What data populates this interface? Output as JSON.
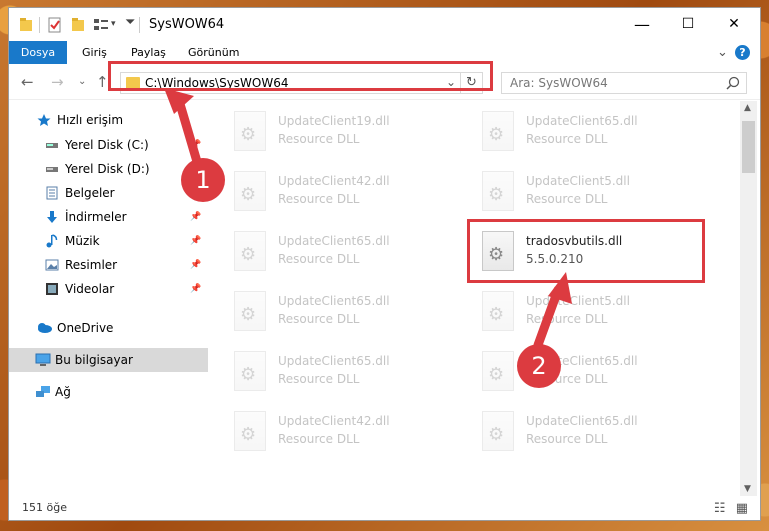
{
  "window": {
    "title": "SysWOW64",
    "controls": {
      "minimize": "—",
      "maximize": "☐",
      "close": "✕"
    }
  },
  "ribbon": {
    "tabs": [
      "Dosya",
      "Giriş",
      "Paylaş",
      "Görünüm"
    ],
    "active_tab": "Dosya",
    "expand_glyph": "⌄",
    "help": "?"
  },
  "addressbar": {
    "path": "C:\\Windows\\SysWOW64",
    "dropdown_glyph": "⌄",
    "refresh_glyph": "↻"
  },
  "search": {
    "placeholder": "Ara: SysWOW64",
    "icon": "search-icon"
  },
  "nav": {
    "back": "←",
    "forward": "→",
    "recent": "⌄",
    "up": "↑"
  },
  "navpane": {
    "items": [
      {
        "label": "Hızlı erişim",
        "icon": "star-icon",
        "pinned": false
      },
      {
        "label": "Yerel Disk (C:)",
        "icon": "drive-icon",
        "pinned": true
      },
      {
        "label": "Yerel Disk (D:)",
        "icon": "drive-icon",
        "pinned": true
      },
      {
        "label": "Belgeler",
        "icon": "document-icon",
        "pinned": true
      },
      {
        "label": "İndirmeler",
        "icon": "download-icon",
        "pinned": true
      },
      {
        "label": "Müzik",
        "icon": "music-icon",
        "pinned": true
      },
      {
        "label": "Resimler",
        "icon": "pictures-icon",
        "pinned": true
      },
      {
        "label": "Videolar",
        "icon": "video-icon",
        "pinned": true
      },
      {
        "label": "OneDrive",
        "icon": "cloud-icon",
        "pinned": false
      },
      {
        "label": "Bu bilgisayar",
        "icon": "computer-icon",
        "pinned": false,
        "selected": true
      },
      {
        "label": "Ağ",
        "icon": "network-icon",
        "pinned": false
      }
    ]
  },
  "files": [
    {
      "name": "UpdateClient19.dll",
      "type": "Resource DLL",
      "faded": true
    },
    {
      "name": "UpdateClient65.dll",
      "type": "Resource DLL",
      "faded": true
    },
    {
      "name": "UpdateClient42.dll",
      "type": "Resource DLL",
      "faded": true
    },
    {
      "name": "UpdateClient5.dll",
      "type": "Resource DLL",
      "faded": true
    },
    {
      "name": "UpdateClient65.dll",
      "type": "Resource DLL",
      "faded": true
    },
    {
      "name": "tradosvbutils.dll",
      "type": "5.5.0.210",
      "faded": false
    },
    {
      "name": "UpdateClient65.dll",
      "type": "Resource DLL",
      "faded": true
    },
    {
      "name": "UpdateClient5.dll",
      "type": "Resource DLL",
      "faded": true
    },
    {
      "name": "UpdateClient65.dll",
      "type": "Resource DLL",
      "faded": true
    },
    {
      "name": "UpdateClient65.dll",
      "type": "Resource DLL",
      "faded": true
    },
    {
      "name": "UpdateClient42.dll",
      "type": "Resource DLL",
      "faded": true
    },
    {
      "name": "UpdateClient65.dll",
      "type": "Resource DLL",
      "faded": true
    }
  ],
  "status": {
    "count": "151 öğe"
  },
  "callouts": {
    "one": "1",
    "two": "2"
  },
  "colors": {
    "accent": "#1979ca",
    "highlight": "#dc3b40",
    "selection": "#d9d9d9"
  }
}
